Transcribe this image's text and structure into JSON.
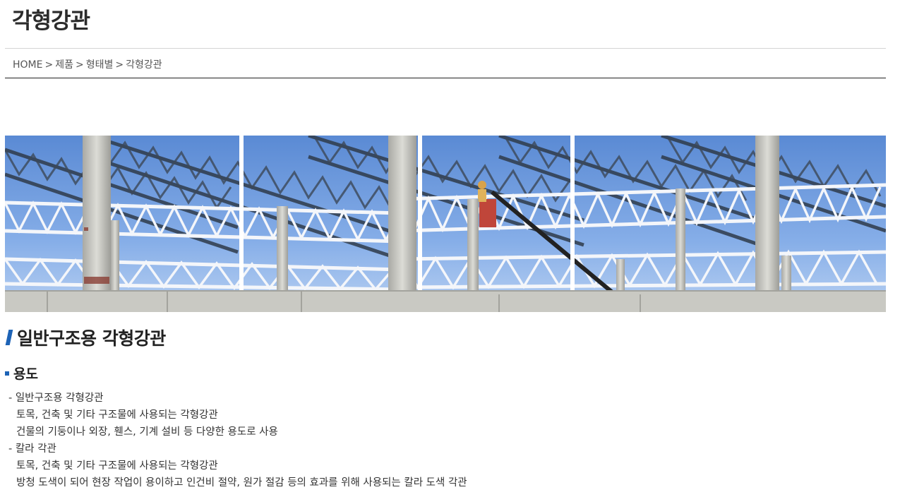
{
  "page": {
    "title": "각형강관"
  },
  "breadcrumb": {
    "items": [
      "HOME",
      "제품",
      "형태별",
      "각형강관"
    ],
    "separator": ">"
  },
  "hero": {
    "image_alt": "steel truss construction"
  },
  "section": {
    "title": "일반구조용 각형강관",
    "sub_title": "용도",
    "usages": [
      {
        "name": "일반구조용 각형강관",
        "lines": [
          "토목, 건축 및 기타 구조물에 사용되는 각형강관",
          "건물의 기둥이나 외장, 휀스, 기계 설비 등 다양한 용도로 사용"
        ]
      },
      {
        "name": "칼라 각관",
        "lines": [
          "토목, 건축 및 기타 구조물에 사용되는 각형강관",
          "방청 도색이 되어 현장 작업이 용이하고 인건비 절약, 원가 절감 등의 효과를 위해 사용되는 칼라 도색 각관"
        ]
      }
    ]
  },
  "colors": {
    "accent": "#1d63b6",
    "sky": "#7ea8e6",
    "text": "#333333"
  }
}
